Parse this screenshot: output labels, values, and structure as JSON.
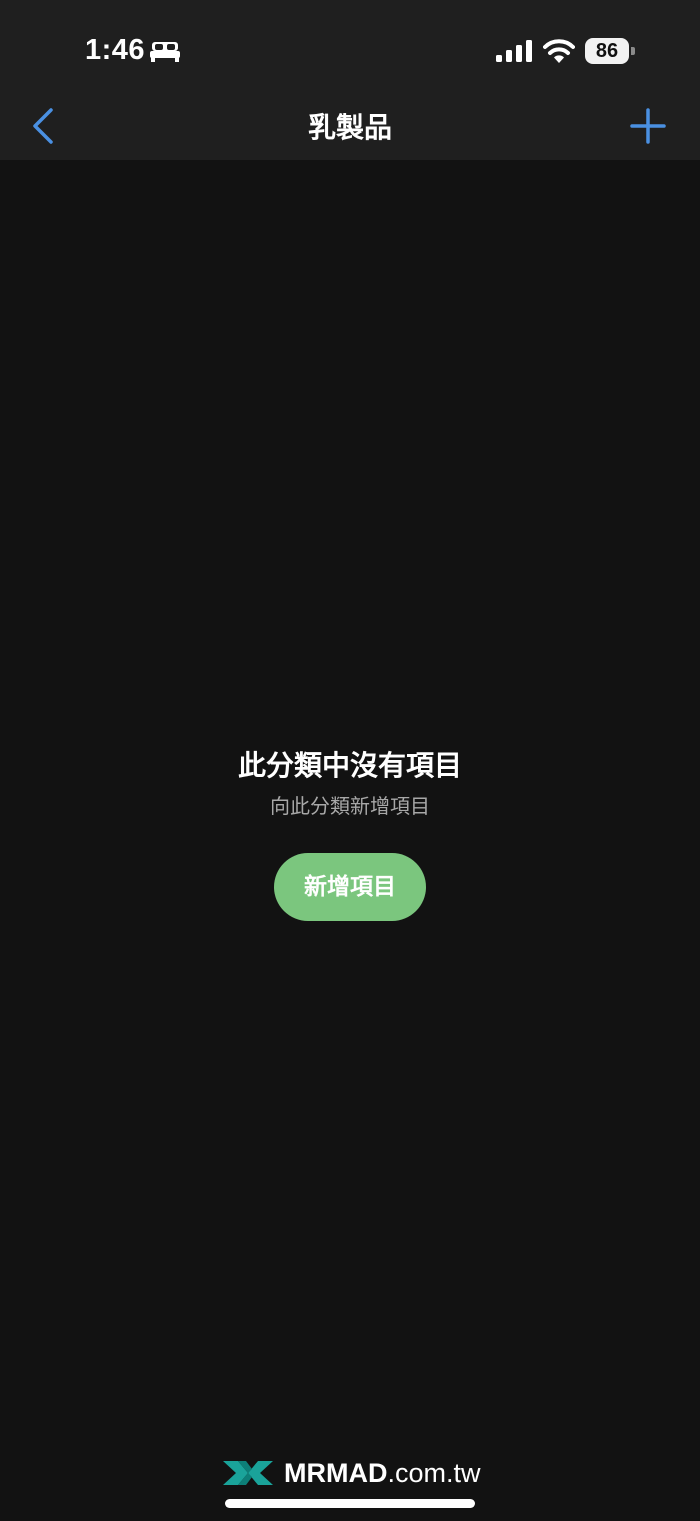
{
  "status_bar": {
    "time": "1:46",
    "focus_icon": "bed-icon",
    "signal_icon": "cellular-signal-icon",
    "wifi_icon": "wifi-icon",
    "battery_level": "86"
  },
  "nav": {
    "back_icon": "chevron-left-icon",
    "title": "乳製品",
    "add_icon": "plus-icon"
  },
  "empty_state": {
    "title": "此分類中沒有項目",
    "subtitle": "向此分類新增項目",
    "add_button_label": "新增項目"
  },
  "watermark": {
    "brand": "MRMAD",
    "domain": ".com.tw"
  },
  "colors": {
    "accent_blue": "#4a90e2",
    "button_green": "#7bc67e",
    "background": "#121212",
    "bar_background": "#1f1f1f"
  }
}
